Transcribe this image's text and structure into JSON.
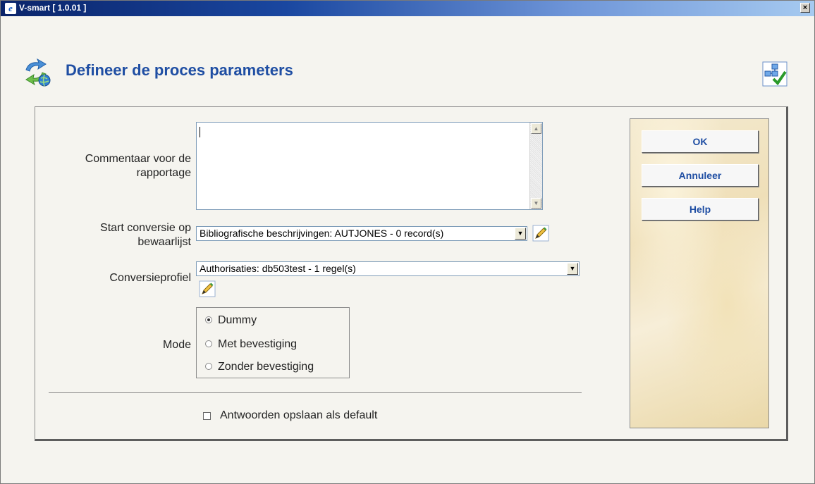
{
  "window": {
    "title": "V-smart [ 1.0.01 ]",
    "close_label": "×"
  },
  "page": {
    "title": "Defineer de proces parameters"
  },
  "form": {
    "comment_label_1": "Commentaar voor de",
    "comment_label_2": "rapportage",
    "comment_value": "",
    "start_label_1": "Start conversie op",
    "start_label_2": "bewaarlijst",
    "start_value": "Bibliografische beschrijvingen: AUTJONES - 0 record(s)",
    "profile_label": "Conversieprofiel",
    "profile_value": "Authorisaties: db503test - 1 regel(s)",
    "mode_label": "Mode",
    "mode_options": [
      "Dummy",
      "Met bevestiging",
      "Zonder bevestiging"
    ],
    "mode_selected": "Dummy",
    "save_default_label": "Antwoorden opslaan als default",
    "save_default_checked": false
  },
  "buttons": {
    "ok": "OK",
    "cancel": "Annuleer",
    "help": "Help"
  },
  "icons": {
    "app": "ie-icon",
    "page": "refresh-globe-icon",
    "corner": "workflow-check-icon",
    "edit": "pencil-edit-icon"
  },
  "colors": {
    "title_blue": "#1f4ea3",
    "titlebar_dark": "#0a246a",
    "titlebar_light": "#a6caf0"
  }
}
